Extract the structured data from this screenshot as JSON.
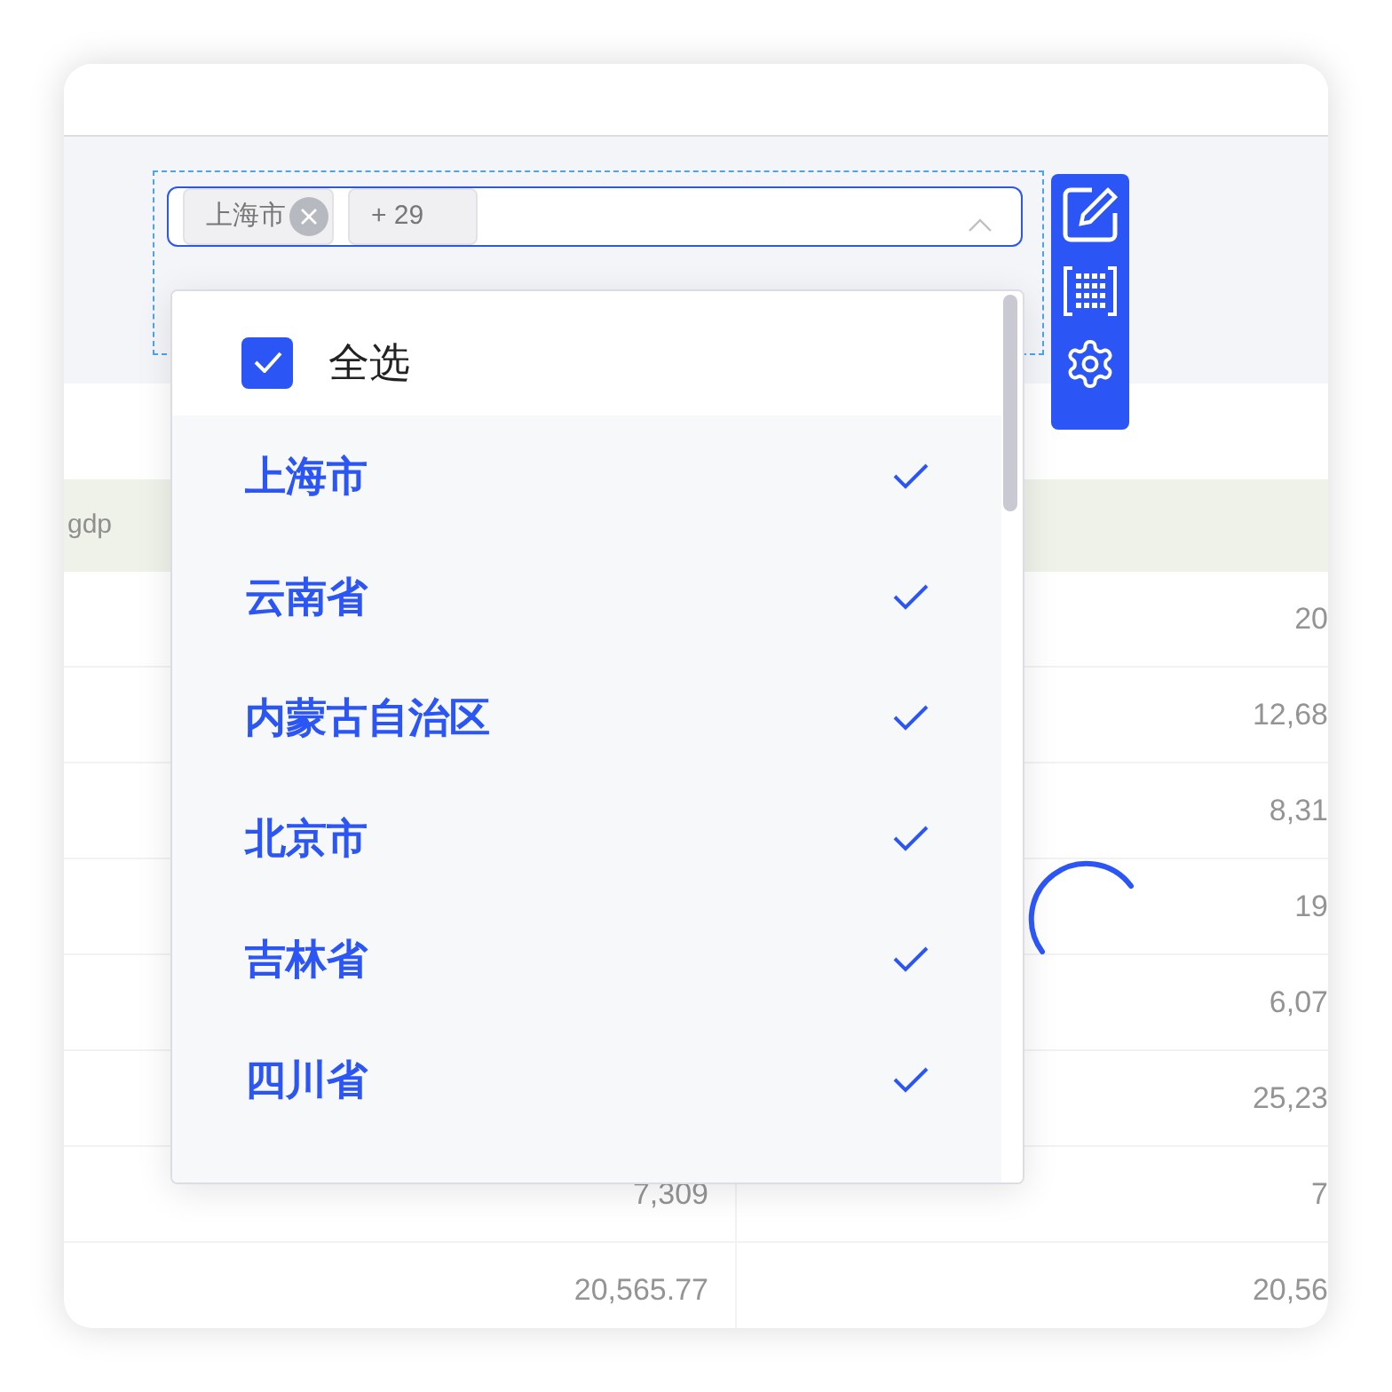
{
  "filter": {
    "tags": [
      {
        "label": "上海市"
      }
    ],
    "more": "+ 29",
    "select_all": {
      "label": "全选",
      "checked": true
    },
    "options": [
      {
        "label": "上海市",
        "selected": true
      },
      {
        "label": "云南省",
        "selected": true
      },
      {
        "label": "内蒙古自治区",
        "selected": true
      },
      {
        "label": "北京市",
        "selected": true
      },
      {
        "label": "吉林省",
        "selected": true
      },
      {
        "label": "四川省",
        "selected": true
      }
    ]
  },
  "table": {
    "header": "gdp",
    "rows": [
      {
        "column_2": "20"
      },
      {
        "column_2": "12,68"
      },
      {
        "column_2": "8,31"
      },
      {
        "column_2": "19"
      },
      {
        "column_2": "6,07"
      },
      {
        "column_2": "25,23"
      },
      {
        "column_1": "7,309",
        "column_2": "7"
      },
      {
        "column_1": "20,565.77",
        "column_2": "20,56"
      }
    ]
  }
}
